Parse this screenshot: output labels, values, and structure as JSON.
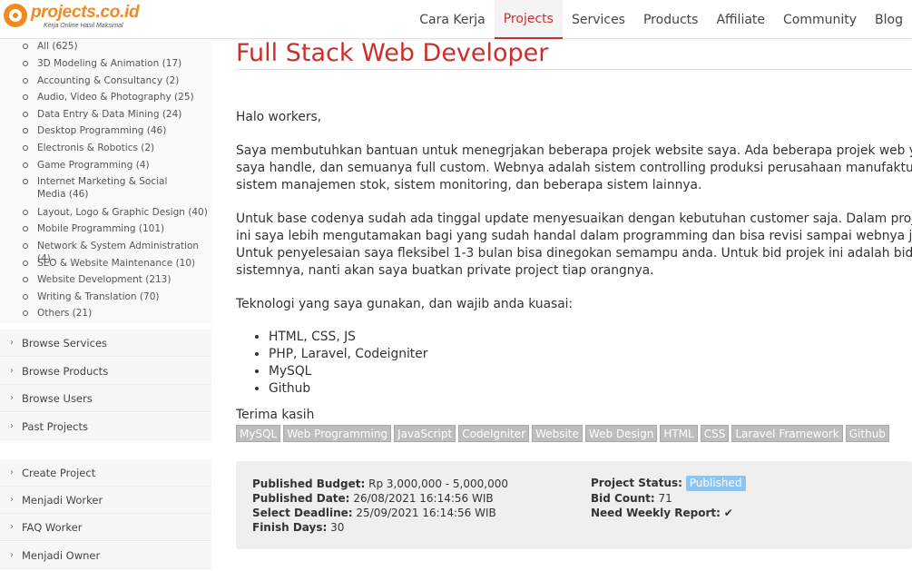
{
  "header": {
    "logo_text": "projects.co.id",
    "logo_tagline": "Kerja Online Hasil Maksimal",
    "nav": [
      {
        "label": "Cara Kerja"
      },
      {
        "label": "Projects"
      },
      {
        "label": "Services"
      },
      {
        "label": "Products"
      },
      {
        "label": "Affiliate"
      },
      {
        "label": "Community"
      },
      {
        "label": "Blog"
      }
    ],
    "active_nav": "Projects"
  },
  "sidebar": {
    "categories": [
      "All (625)",
      "3D Modeling & Animation (17)",
      "Accounting & Consultancy (2)",
      "Audio, Video & Photography (25)",
      "Data Entry & Data Mining (24)",
      "Desktop Programming (46)",
      "Electronis & Robotics (2)",
      "Game Programming (4)",
      "Internet Marketing & Social Media (46)",
      "Layout, Logo & Graphic Design (40)",
      "Mobile Programming (101)",
      "Network & System Administration (4)",
      "SEO & Website Maintenance (10)",
      "Website Development (213)",
      "Writing & Translation (70)",
      "Others (21)"
    ],
    "links": [
      "Browse Services",
      "Browse Products",
      "Browse Users",
      "Past Projects",
      "Create Project",
      "Menjadi Worker",
      "FAQ Worker",
      "Menjadi Owner"
    ]
  },
  "project": {
    "title": "Full Stack Web Developer",
    "greeting": "Halo workers,",
    "p1": [
      "Saya membutuhkan bantuan untuk menegrjakan beberapa projek website saya. Ada beberapa projek web yang",
      "saya handle, dan semuanya full custom. Webnya adalah sistem controlling produksi perusahaan manufaktur,",
      "sistem manajemen stok, sistem monitoring, dan beberapa sistem lainnya."
    ],
    "p2": [
      "Untuk base codenya sudah ada tinggal update menyesuaikan dengan kebutuhan customer saja. Dalam projek",
      "ini saya lebih mengutamakan bagi yang sudah handal dalam programming dan bisa revisi sampai webnya jadi.",
      "Untuk penyelesaian saya fleksibel 1-3 bulan bisa dinegokan semampu anda. Untuk bid projek ini adalah bid per",
      "sistemnya, nanti akan saya buatkan private project tiap orangnya."
    ],
    "tech_intro": "Teknologi yang saya gunakan, dan wajib anda kuasai:",
    "tech": [
      "HTML, CSS, JS",
      "PHP, Laravel, Codeigniter",
      "MySQL",
      "Github"
    ],
    "closing": "Terima kasih",
    "tags": [
      "MySQL",
      "Web Programming",
      "JavaScript",
      "CodeIgniter",
      "Website",
      "Web Design",
      "HTML",
      "CSS",
      "Laravel Framework",
      "Github"
    ],
    "info": {
      "budget_label": "Published Budget:",
      "budget": "Rp 3,000,000 - 5,000,000",
      "published_date_label": "Published Date:",
      "published_date": "26/08/2021 16:14:56 WIB",
      "deadline_label": "Select Deadline:",
      "deadline": "25/09/2021 16:14:56 WIB",
      "finish_days_label": "Finish Days:",
      "finish_days": "30",
      "status_label": "Project Status:",
      "status": "Published",
      "bid_count_label": "Bid Count:",
      "bid_count": "71",
      "weekly_report_label": "Need Weekly Report:",
      "weekly_report": "✔"
    }
  }
}
